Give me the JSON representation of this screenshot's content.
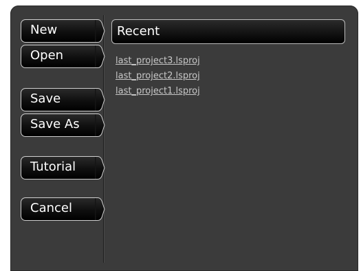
{
  "sidebar": {
    "buttons": [
      {
        "id": "new",
        "label": "New"
      },
      {
        "id": "open",
        "label": "Open"
      },
      {
        "id": "save",
        "label": "Save"
      },
      {
        "id": "save_as",
        "label": "Save As"
      },
      {
        "id": "tutorial",
        "label": "Tutorial"
      },
      {
        "id": "cancel",
        "label": "Cancel"
      }
    ]
  },
  "recent": {
    "title": "Recent",
    "files": [
      "last_project3.lsproj",
      "last_project2.lsproj",
      "last_project1.lsproj"
    ]
  },
  "colors": {
    "dialog_bg": "#3b3b3b",
    "button_bg": "#0a0a0a",
    "button_border": "#d0d0d0",
    "link_text": "#c8c8c8"
  }
}
